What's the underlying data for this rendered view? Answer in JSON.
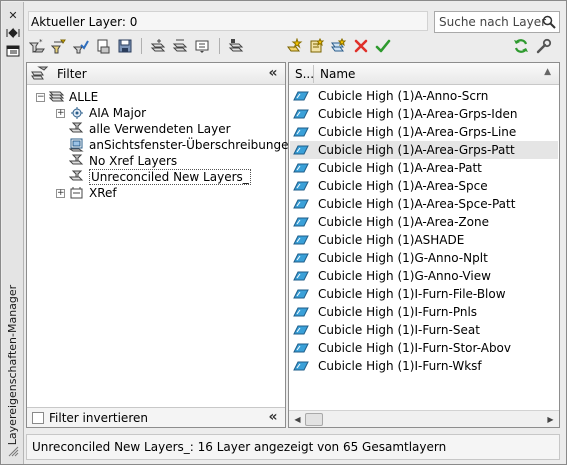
{
  "window": {
    "title": "Layereigenschaften-Manager",
    "current_layer_label": "Aktueller Layer: 0"
  },
  "search": {
    "placeholder": "Suche nach Layer"
  },
  "toolbar": {
    "icons": [
      "new-property-filter-icon",
      "new-group-filter-icon",
      "layer-states-manager-icon",
      "save-layer-state-icon",
      "new-layer-icon",
      "new-layer-vp-frozen-icon",
      "delete-layer-icon",
      "set-current-icon",
      "refresh-icon",
      "settings-icon"
    ]
  },
  "filter_panel": {
    "header": "Filter",
    "tree": [
      {
        "label": "ALLE",
        "level": 0,
        "expander": "−"
      },
      {
        "label": "AIA Major",
        "level": 1,
        "expander": "+"
      },
      {
        "label": "alle Verwendeten Layer",
        "level": 1
      },
      {
        "label": "anSichtsfenster-Überschreibungen",
        "level": 1
      },
      {
        "label": "No Xref Layers",
        "level": 1
      },
      {
        "label": "Unreconciled New Layers_",
        "level": 1,
        "selected": true
      },
      {
        "label": "XRef",
        "level": 1,
        "expander": "+"
      }
    ],
    "invert_filter": "Filter invertieren",
    "invert_checked": false
  },
  "layer_list": {
    "columns": {
      "status": "S...",
      "name": "Name"
    },
    "rows": [
      "Cubicle High (1)A-Anno-Scrn",
      "Cubicle High (1)A-Area-Grps-Iden",
      "Cubicle High (1)A-Area-Grps-Line",
      "Cubicle High (1)A-Area-Grps-Patt",
      "Cubicle High (1)A-Area-Patt",
      "Cubicle High (1)A-Area-Spce",
      "Cubicle High (1)A-Area-Spce-Patt",
      "Cubicle High (1)A-Area-Zone",
      "Cubicle High (1)ASHADE",
      "Cubicle High (1)G-Anno-Nplt",
      "Cubicle High (1)G-Anno-View",
      "Cubicle High (1)I-Furn-File-Blow",
      "Cubicle High (1)I-Furn-Pnls",
      "Cubicle High (1)I-Furn-Seat",
      "Cubicle High (1)I-Furn-Stor-Abov",
      "Cubicle High (1)I-Furn-Wksf"
    ],
    "highlighted_row": 3
  },
  "status_bar": {
    "text": "Unreconciled New Layers_: 16 Layer angezeigt von 65 Gesamtlayern"
  },
  "colors": {
    "layer_icon": "#3aa0d8",
    "delete": "#e0302a",
    "check": "#2e9a2e",
    "refresh": "#2e9a2e"
  }
}
